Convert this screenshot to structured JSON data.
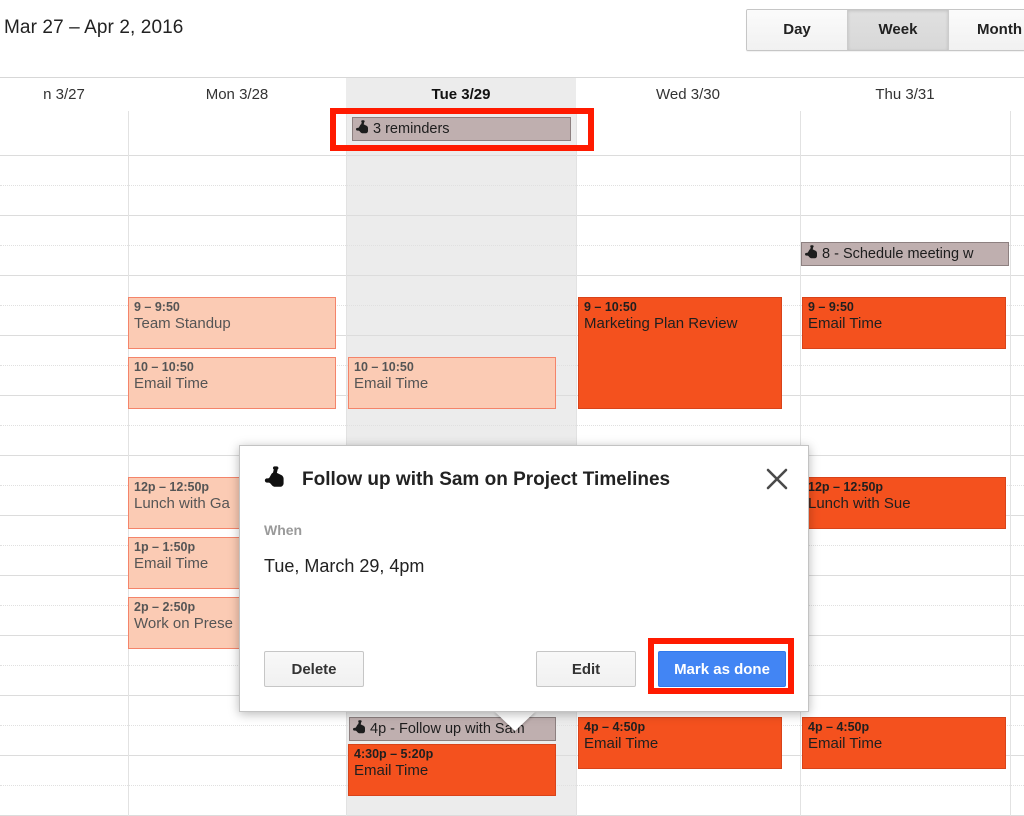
{
  "header": {
    "date_range": "Mar 27 – Apr 2, 2016",
    "views": [
      {
        "label": "Day",
        "active": false
      },
      {
        "label": "Week",
        "active": true
      },
      {
        "label": "Month",
        "active": false
      }
    ]
  },
  "calendar": {
    "columns": [
      {
        "label": "n 3/27",
        "today": false
      },
      {
        "label": "Mon 3/28",
        "today": false
      },
      {
        "label": "Tue 3/29",
        "today": true
      },
      {
        "label": "Wed 3/30",
        "today": false
      },
      {
        "label": "Thu 3/31",
        "today": false
      }
    ],
    "allday_reminder": {
      "label": "3 reminders",
      "icon": "reminder-hand-icon"
    },
    "reminders": [
      {
        "label": "8 - Schedule meeting w",
        "icon": "reminder-hand-icon"
      },
      {
        "label": "4p - Follow up with Sam",
        "icon": "reminder-hand-icon"
      }
    ],
    "events": [
      {
        "time": "9 – 9:50",
        "title": "Team Standup",
        "style": "pale"
      },
      {
        "time": "10 – 10:50",
        "title": "Email Time",
        "style": "pale"
      },
      {
        "time": "12p – 12:50p",
        "title": "Lunch with Ga",
        "style": "pale"
      },
      {
        "time": "1p – 1:50p",
        "title": "Email Time",
        "style": "pale"
      },
      {
        "time": "2p – 2:50p",
        "title": "Work on Prese",
        "style": "pale"
      },
      {
        "time": "10 – 10:50",
        "title": "Email Time",
        "style": "pale"
      },
      {
        "time": "4:30p – 5:20p",
        "title": "Email Time",
        "style": "solid"
      },
      {
        "time": "9 – 10:50",
        "title": "Marketing Plan Review",
        "style": "solid"
      },
      {
        "time": "4p – 4:50p",
        "title": "Email Time",
        "style": "solid"
      },
      {
        "time": "9 – 9:50",
        "title": "Email Time",
        "style": "solid"
      },
      {
        "time": "12p – 12:50p",
        "title": "Lunch with Sue",
        "style": "solid"
      },
      {
        "time": "4p – 4:50p",
        "title": "Email Time",
        "style": "solid"
      }
    ]
  },
  "dialog": {
    "title": "Follow up with Sam on Project Timelines",
    "icon": "reminder-hand-icon",
    "close_icon": "close-icon",
    "when_label": "When",
    "when_value": "Tue, March 29, 4pm",
    "buttons": {
      "delete": "Delete",
      "edit": "Edit",
      "mark_as_done": "Mark as done"
    }
  },
  "annotations": {
    "highlight_color": "#FF1A00",
    "targets": [
      "3 reminders",
      "Mark as done"
    ]
  },
  "colors": {
    "event_solid": "#F4511E",
    "event_pale": "#FBCBB4",
    "reminder_chip": "#BFAFAF",
    "primary_button": "#4285F4",
    "today_column": "#ECECEC"
  }
}
